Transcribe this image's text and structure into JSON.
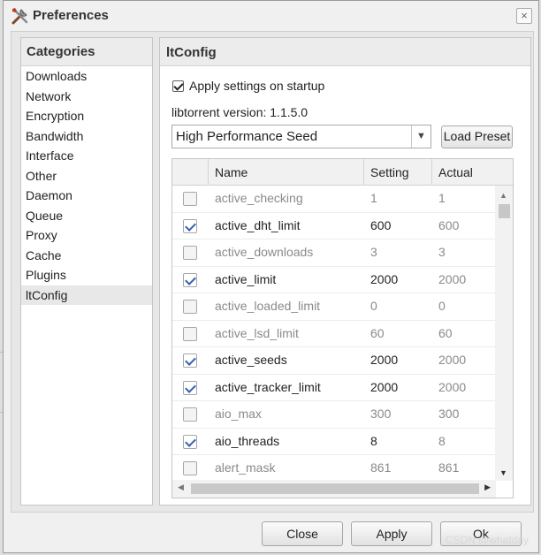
{
  "window": {
    "title": "Preferences",
    "close_glyph": "×"
  },
  "categories": {
    "header": "Categories",
    "selected_index": 11,
    "items": [
      {
        "label": "Downloads"
      },
      {
        "label": "Network"
      },
      {
        "label": "Encryption"
      },
      {
        "label": "Bandwidth"
      },
      {
        "label": "Interface"
      },
      {
        "label": "Other"
      },
      {
        "label": "Daemon"
      },
      {
        "label": "Queue"
      },
      {
        "label": "Proxy"
      },
      {
        "label": "Cache"
      },
      {
        "label": "Plugins"
      },
      {
        "label": "ltConfig"
      }
    ]
  },
  "ltconfig": {
    "header": "ltConfig",
    "apply_on_startup": {
      "label": "Apply settings on startup",
      "checked": true
    },
    "version_text": "libtorrent version: 1.1.5.0",
    "preset": {
      "selected": "High Performance Seed"
    },
    "load_preset_label": "Load Preset",
    "columns": {
      "name": "Name",
      "setting": "Setting",
      "actual": "Actual"
    },
    "rows": [
      {
        "checked": false,
        "name": "active_checking",
        "setting": "1",
        "actual": "1"
      },
      {
        "checked": true,
        "name": "active_dht_limit",
        "setting": "600",
        "actual": "600"
      },
      {
        "checked": false,
        "name": "active_downloads",
        "setting": "3",
        "actual": "3"
      },
      {
        "checked": true,
        "name": "active_limit",
        "setting": "2000",
        "actual": "2000"
      },
      {
        "checked": false,
        "name": "active_loaded_limit",
        "setting": "0",
        "actual": "0"
      },
      {
        "checked": false,
        "name": "active_lsd_limit",
        "setting": "60",
        "actual": "60"
      },
      {
        "checked": true,
        "name": "active_seeds",
        "setting": "2000",
        "actual": "2000"
      },
      {
        "checked": true,
        "name": "active_tracker_limit",
        "setting": "2000",
        "actual": "2000"
      },
      {
        "checked": false,
        "name": "aio_max",
        "setting": "300",
        "actual": "300"
      },
      {
        "checked": true,
        "name": "aio_threads",
        "setting": "8",
        "actual": "8"
      },
      {
        "checked": false,
        "name": "alert_mask",
        "setting": "861",
        "actual": "861"
      }
    ]
  },
  "footer": {
    "close_label": "Close",
    "apply_label": "Apply",
    "ok_label": "Ok"
  },
  "watermark": "CSDN @whatday"
}
